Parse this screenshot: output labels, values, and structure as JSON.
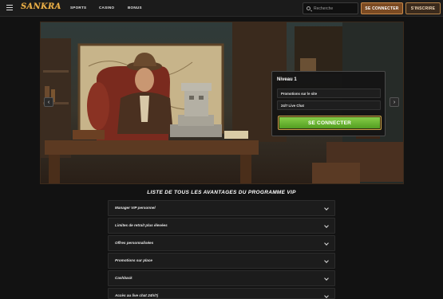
{
  "header": {
    "logo_text": "SANKRA",
    "nav": [
      "SPORTS",
      "CASINO",
      "BONUS"
    ],
    "search_placeholder": "Recherche",
    "login_label": "SE CONNECTER",
    "register_label": "S'INSCRIRE"
  },
  "hero": {
    "level_title": "Niveau 1",
    "perks": [
      "Promotions sur le site",
      "24/7 Live Chat"
    ],
    "cta_label": "SE CONNECTER",
    "prev_arrow": "‹",
    "next_arrow": "›"
  },
  "vip": {
    "heading": "LISTE DE TOUS LES AVANTAGES DU PROGRAMME VIP",
    "items": [
      "Manager VIP personnel",
      "Limites de retrait plus élevées",
      "Offres personnalisées",
      "Promotions sur place",
      "Cashback",
      "Accès au live chat 24h/7j"
    ]
  },
  "colors": {
    "background": "#121212",
    "accent": "#c98a4a",
    "cta_green": "#6fb631"
  }
}
